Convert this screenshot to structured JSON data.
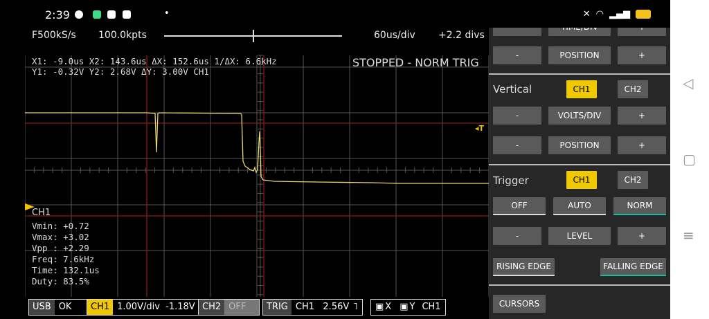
{
  "status_bar": {
    "time": "2:39",
    "dot": "•"
  },
  "scope": {
    "sample_rate": "F500kS/s",
    "points": "100.0kpts",
    "time_div": "60us/div",
    "offset": "+2.2 divs",
    "cursor_line1": "X1: -9.0us  X2: 143.6us  ΔX: 152.6us  1/ΔX: 6.6kHz",
    "cursor_line2": "Y1: -0.32V  Y2: 2.68V  ΔY: 3.00V CH1",
    "run_status": "STOPPED - NORM TRIG",
    "trigger_marker": "◂T",
    "channel_label": "CH1",
    "measurements": {
      "vmin": "Vmin: +0.72",
      "vmax": "Vmax: +3.02",
      "vpp": "Vpp : +2.29",
      "freq": "Freq: 7.6kHz",
      "time": "Time: 132.1us",
      "duty": "Duty: 83.5%"
    }
  },
  "bottom_bar": {
    "usb": {
      "tag": "USB",
      "value": "OK"
    },
    "ch1": {
      "tag": "CH1",
      "value": "1.00V/div  -1.18V"
    },
    "ch2": {
      "tag": "CH2",
      "value": "OFF"
    },
    "trig": {
      "tag": "TRIG",
      "value": "CH1   2.56V"
    },
    "xy": {
      "x": "X",
      "y": "Y",
      "ch": "CH1"
    }
  },
  "panel": {
    "time_div_label": "TIME/DIV",
    "position_label": "POSITION",
    "minus": "-",
    "plus": "+",
    "vertical": {
      "label": "Vertical",
      "ch1": "CH1",
      "ch2": "CH2",
      "volts_div": "VOLTS/DIV",
      "position": "POSITION"
    },
    "trigger": {
      "label": "Trigger",
      "ch1": "CH1",
      "ch2": "CH2",
      "off": "OFF",
      "auto": "AUTO",
      "norm": "NORM",
      "level": "LEVEL",
      "rising": "RISING EDGE",
      "falling": "FALLING EDGE"
    },
    "cursors": "CURSORS"
  },
  "colors": {
    "trace": "#e8d870",
    "grid": "#555555",
    "cursor_line": "#8b1a1a",
    "accent_yellow": "#f0c800",
    "active_green": "#1abc9c"
  }
}
